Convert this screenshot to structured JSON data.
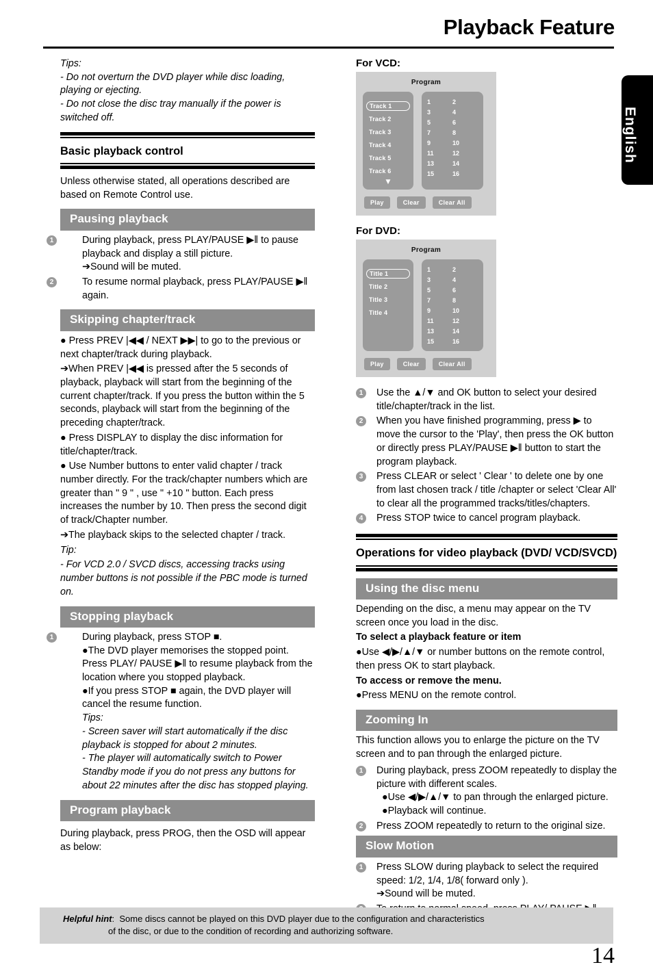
{
  "header": {
    "title": "Playback Feature",
    "language_tab": "English"
  },
  "left": {
    "tips_intro": {
      "label": "Tips:",
      "lines": [
        "- Do not overturn the DVD player while disc loading, playing or ejecting.",
        "- Do not close the disc tray manually if the power is switched off."
      ]
    },
    "section_title": "Basic playback control",
    "section_intro": "Unless otherwise stated, all operations described are based on Remote Control use.",
    "pausing": {
      "bar": "Pausing playback",
      "items": [
        "During playback, press PLAY/PAUSE ▶‖ to pause playback and display a still picture.",
        "To resume normal playback, press PLAY/PAUSE ▶‖ again."
      ],
      "arrow_note": "➔Sound will be muted."
    },
    "skipping": {
      "bar": "Skipping chapter/track",
      "p1": "● Press PREV |◀◀ / NEXT ▶▶| to go to the previous or next chapter/track during playback.",
      "p2": "➔When PREV |◀◀ is pressed after the 5 seconds of playback, playback will start from the beginning of the current chapter/track. If you press the button within the 5 seconds, playback will start from the beginning of the preceding chapter/track.",
      "p3": "● Press DISPLAY to display the disc information for title/chapter/track.",
      "p4": "● Use Number buttons to enter valid chapter / track number directly. For the track/chapter numbers which are greater than \" 9 \" , use \" +10 \"  button. Each press increases the number by 10. Then press the second digit of track/Chapter number.",
      "p5": "➔The playback skips to the selected chapter / track.",
      "tip_label": "Tip:",
      "tip_text": "- For VCD 2.0 / SVCD discs, accessing tracks using number buttons is not possible if the PBC mode is turned on."
    },
    "stopping": {
      "bar": "Stopping playback",
      "item1": "During playback, press STOP ■.",
      "b1": "●The DVD player memorises the stopped point. Press PLAY/ PAUSE ▶‖ to resume playback from the location where you stopped playback.",
      "b2": "●If you press STOP ■ again, the DVD player will cancel the resume function.",
      "tips_label": "Tips:",
      "tip1": "- Screen saver will start automatically if the disc playback is stopped for about 2 minutes.",
      "tip2": "- The player will automatically switch to Power Standby mode if you do not press any buttons for about 22 minutes after the disc has stopped playing."
    },
    "program": {
      "bar": "Program playback",
      "text": "During playback, press  PROG, then the OSD will appear as below:"
    }
  },
  "right": {
    "vcd_label": "For VCD:",
    "dvd_label": "For DVD:",
    "osd_vcd": {
      "title": "Program",
      "items": [
        "Track 1",
        "Track 2",
        "Track 3",
        "Track 4",
        "Track 5",
        "Track 6"
      ],
      "selected": "Track 1",
      "scroll_indicator": "▼",
      "numbers": [
        "1",
        "2",
        "3",
        "4",
        "5",
        "6",
        "7",
        "8",
        "9",
        "10",
        "11",
        "12",
        "13",
        "14",
        "15",
        "16"
      ],
      "buttons": [
        "Play",
        "Clear",
        "Clear All"
      ]
    },
    "osd_dvd": {
      "title": "Program",
      "items": [
        "Title 1",
        "Title 2",
        "Title 3",
        "Title 4"
      ],
      "selected": "Title 1",
      "numbers": [
        "1",
        "2",
        "3",
        "4",
        "5",
        "6",
        "7",
        "8",
        "9",
        "10",
        "11",
        "12",
        "13",
        "14",
        "15",
        "16"
      ],
      "buttons": [
        "Play",
        "Clear",
        "Clear All"
      ]
    },
    "program_steps": [
      "Use the ▲/▼ and OK button to select your desired title/chapter/track in the list.",
      "When you have finished programming, press ▶ to move the cursor to the 'Play', then press the OK button or directly press PLAY/PAUSE ▶‖ button to start the program playback.",
      "Press CLEAR or select ' Clear ' to delete one by one from last chosen track / title /chapter or select 'Clear All' to clear all the programmed tracks/titles/chapters.",
      "Press STOP twice to cancel program playback."
    ],
    "section_title": "Operations for video playback (DVD/ VCD/SVCD)",
    "disc_menu": {
      "bar": "Using the disc menu",
      "intro": "Depending on the disc, a menu may appear on the TV screen once you load in the disc.",
      "sub1": "To select a playback feature or item",
      "sub1_text": "●Use ◀/▶/▲/▼ or number buttons on the remote control, then press OK to start playback.",
      "sub2": "To access or remove the menu.",
      "sub2_text": "●Press MENU on the remote control."
    },
    "zooming": {
      "bar": "Zooming In",
      "intro": "This function allows you to enlarge the picture on the TV screen and to pan through the enlarged picture.",
      "item1": "During playback, press ZOOM repeatedly to display the picture with different scales.",
      "b1": "●Use ◀/▶/▲/▼ to pan through the enlarged picture.",
      "b2": "●Playback will continue.",
      "item2": "Press ZOOM repeatedly to return to the original size."
    },
    "slow_motion": {
      "bar": "Slow Motion",
      "item1": "Press SLOW during playback to select the required speed: 1/2, 1/4, 1/8( forward only ).",
      "arrow_note": "➔Sound will be muted.",
      "item2": "To return to normal speed, press PLAY/ PAUSE ▶‖."
    }
  },
  "footer": {
    "hint_label": "Helpful hint",
    "hint_sep": ":",
    "hint_line1": "Some discs cannot be played on this DVD player due to the configuration and characteristics",
    "hint_line2": "of the disc, or due to the condition of recording and authorizing software.",
    "page_number": "14"
  },
  "colors": {
    "bar_gray": "#8d8d8d",
    "osd_bg": "#d0d0d0",
    "osd_panel": "#9b9b9b",
    "hint_bg": "#d2d2d2",
    "num_badge": "#9a9a9a"
  }
}
